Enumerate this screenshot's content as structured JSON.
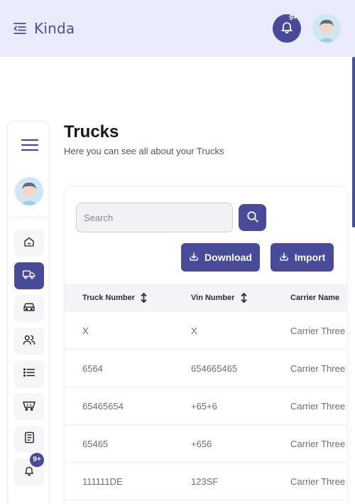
{
  "topbar": {
    "brand": "Kinda",
    "notification_badge": "9+"
  },
  "page": {
    "title": "Trucks",
    "subtitle": "Here you can see all about your Trucks"
  },
  "search": {
    "placeholder": "Search",
    "value": ""
  },
  "actions": {
    "download_label": "Download",
    "import_label": "Import"
  },
  "table": {
    "columns": [
      {
        "label": "Truck Number"
      },
      {
        "label": "Vin Number"
      },
      {
        "label": "Carrier Name"
      }
    ],
    "rows": [
      {
        "truck_number": "X",
        "vin_number": "X",
        "carrier_name": "Carrier Three"
      },
      {
        "truck_number": "6564",
        "vin_number": "654665465",
        "carrier_name": "Carrier Three"
      },
      {
        "truck_number": "65465654",
        "vin_number": "+65+6",
        "carrier_name": "Carrier Three"
      },
      {
        "truck_number": "65465",
        "vin_number": "+656",
        "carrier_name": "Carrier Three"
      },
      {
        "truck_number": "111111DE",
        "vin_number": "123SF",
        "carrier_name": "Carrier Three"
      }
    ]
  },
  "sidebar": {
    "notification_badge": "9+",
    "items": [
      {
        "icon": "home-icon"
      },
      {
        "icon": "truck-icon",
        "active": true
      },
      {
        "icon": "car-icon"
      },
      {
        "icon": "users-icon"
      },
      {
        "icon": "list-icon"
      },
      {
        "icon": "cart-icon"
      },
      {
        "icon": "document-icon"
      },
      {
        "icon": "bell-icon"
      }
    ]
  },
  "colors": {
    "primary": "#474b99",
    "topbar_bg": "#e9ebfb",
    "text_dark": "#15161c",
    "text_muted": "#6b6c78"
  }
}
